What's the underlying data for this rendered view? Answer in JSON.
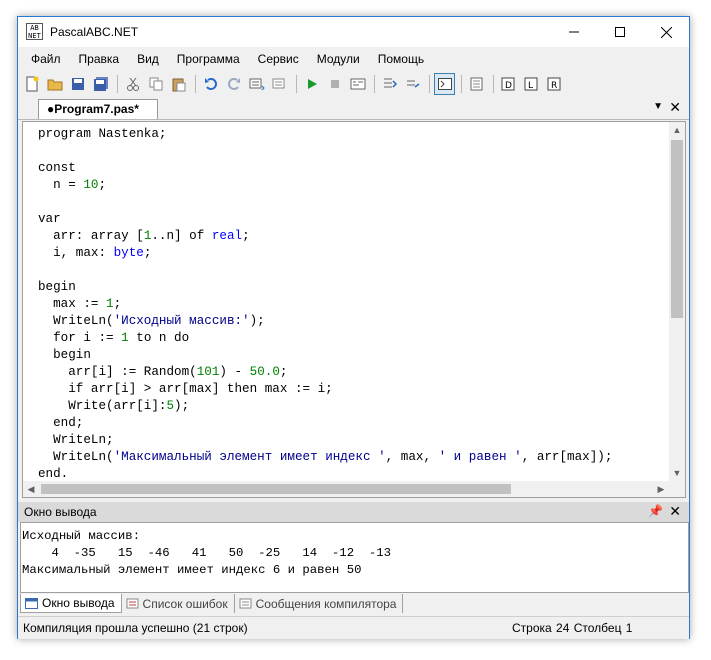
{
  "window": {
    "title": "PascalABC.NET",
    "icon_text": "AB\nNET"
  },
  "menu": [
    "Файл",
    "Правка",
    "Вид",
    "Программа",
    "Сервис",
    "Модули",
    "Помощь"
  ],
  "toolbar_icons": [
    "new-file-icon",
    "open-icon",
    "save-icon",
    "save-all-icon",
    "cut-icon",
    "copy-icon",
    "paste-icon",
    "undo-icon",
    "redo-icon",
    "find-icon",
    "replace-icon",
    "run-icon",
    "stop-icon",
    "compile-icon",
    "step-into-icon",
    "step-over-icon",
    "output-window-icon",
    "debug-window-icon",
    "format-icon",
    "indent-icon",
    "unindent-icon"
  ],
  "editor": {
    "tab_label": "●Program7.pas*",
    "code_lines": [
      "program Nastenka;",
      "",
      "const",
      "  n = 10;",
      "",
      "var",
      "  arr: array [1..n] of real;",
      "  i, max: byte;",
      "",
      "begin",
      "  max := 1;",
      "  WriteLn('Исходный массив:');",
      "  for i := 1 to n do",
      "  begin",
      "    arr[i] := Random(101) - 50.0;",
      "    if arr[i] > arr[max] then max := i;",
      "    Write(arr[i]:5);",
      "  end;",
      "  WriteLn;",
      "  WriteLn('Максимальный элемент имеет индекс ', max, ' и равен ', arr[max]);",
      "end."
    ]
  },
  "output_panel": {
    "title": "Окно вывода",
    "lines": [
      "Исходный массив:",
      "    4  -35   15  -46   41   50  -25   14  -12  -13",
      "Максимальный элемент имеет индекс 6 и равен 50"
    ]
  },
  "bottom_tabs": [
    "Окно вывода",
    "Список ошибок",
    "Сообщения компилятора"
  ],
  "status": {
    "message": "Компиляция прошла успешно (21 строк)",
    "position": "Строка  24  Столбец  1"
  }
}
